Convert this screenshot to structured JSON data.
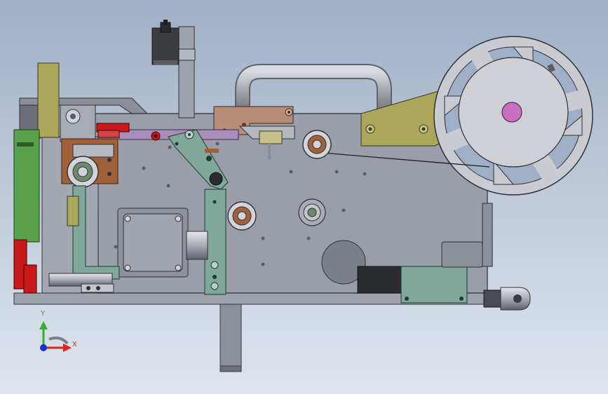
{
  "view": {
    "background_top": "#9fb0c6",
    "background_bottom": "#dfe5ee"
  },
  "triad": {
    "x_label": "X",
    "y_label": "Y",
    "x_color": "#e0231b",
    "y_color": "#2fb52a",
    "z_color": "#1a2fd6"
  },
  "model": {
    "plate_color": "#9a9ea8",
    "accent_colors": {
      "olive": "#aaa65a",
      "green": "#59a14b",
      "teal": "#7fa89a",
      "red": "#c81a1a",
      "copper": "#a0603a",
      "violet": "#a88cba",
      "brown": "#b78d78",
      "reel": "#c9cbd1",
      "hub": "#c86fc0"
    }
  }
}
